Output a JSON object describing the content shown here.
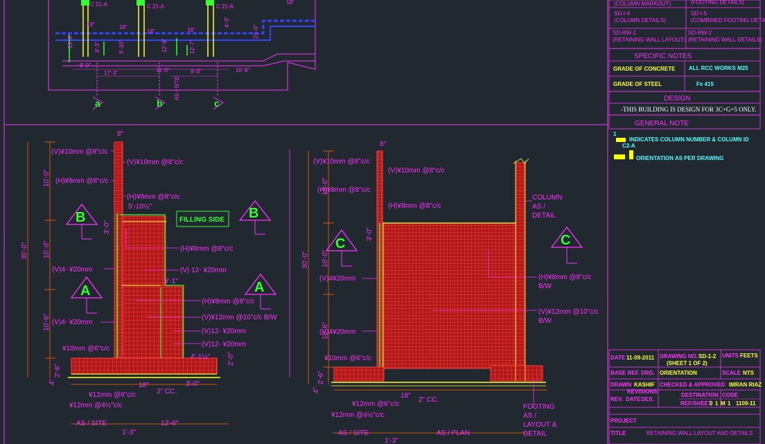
{
  "index": [
    {
      "code": "",
      "desc": "(COLUMN MARKOUT)"
    },
    {
      "code": "",
      "desc": "(FOOTING DETAILS)"
    },
    {
      "code": "SD-I-4",
      "desc": "(COLUMN DETAILS)"
    },
    {
      "code": "SD-I-5",
      "desc": "(COMBINED FOOTING DETAILS)"
    },
    {
      "code": "SD-RW-1",
      "desc": "(RETAINING WALL LAYOUT)"
    },
    {
      "code": "SD-RW-2",
      "desc": "(RETAINING WALL DETAILS)"
    }
  ],
  "specific_notes": {
    "title": "SPECIFIC NOTES",
    "concrete_label": "GRADE OF CONCRETE",
    "concrete_value": "ALL RCC WORKS M25",
    "steel_label": "GRADE OF STEEL",
    "steel_value": "Fe 415"
  },
  "design": {
    "title": "DESIGN",
    "text": "-THIS BUILDING IS DESIGN FOR 3C+G+5 ONLY."
  },
  "general_note": {
    "title": "GENERAL NOTE",
    "num": "1",
    "note1": "INDICATES COLUMN NUMBER & COLUMN ID",
    "note1b": "C2-A",
    "note2": "ORIENTATION AS PER DRAWING"
  },
  "title_block": {
    "date_label": "DATE",
    "date": "11-09-2011",
    "drawing_no_label": "DRAWING NO.",
    "drawing_no": "SD-1-2",
    "sheet": "(SHEET 1 OF 2)",
    "units_label": "UNITS",
    "units": "FEETS",
    "ref_label": "BASE REF. DRG.",
    "ref": "ORIENTATION",
    "scale_label": "SCALE",
    "scale": "NTS",
    "drawn_label": "DRAWN",
    "drawn": "KASHIF",
    "checked_label": "CHECKED & APPROVED",
    "checked": "IMRAN RIAZ",
    "revision_label": "REVISIONS",
    "destination_label": "DESTINATION",
    "ref_no_label": "REF/SHEET",
    "rev_cols": [
      "REV.",
      "DATE",
      "DES."
    ],
    "sheet_values": [
      "0",
      "1",
      "M",
      "1",
      "1109-11"
    ],
    "code_label": "CODE",
    "project_label": "PROJECT",
    "title_label": "TITLE",
    "title": "RETAINING WALL LAYOUT AND DETAILS"
  },
  "plan": {
    "col_labels": [
      "C 21-A",
      "C 21-A",
      "C 21-A"
    ],
    "grid": [
      "a",
      "b",
      "c"
    ],
    "dims": [
      "8'-0\"",
      "17'-3\"",
      "11'-0\"",
      "8'-0\"",
      "10'-8\"",
      "8'-3\"",
      "9'-10\"",
      "12'-9\"",
      "12'-7\"",
      "13'-6\"",
      "21'-0\"",
      "4'-3\""
    ],
    "as_site": "AS / SITE",
    "small": "18\""
  },
  "section1": {
    "top": "8\"",
    "v10": "(V)¥10mm @8\"c/c",
    "v10b": "(V)¥10mm @8\"c/c",
    "h8": "(H)¥8mm @8\"c/c",
    "h8b": "(H)¥8mm @8\"c/c",
    "width1": "5'-10½\"",
    "h8c": "(H)¥8mm @8\"c/c",
    "v12": "(V) 12- ¥20mm",
    "v4a": "(V)4- ¥20mm",
    "width2": "3'-1\"",
    "h8d": "(H)¥8mm @8\"c/c",
    "v12b": "(V)¥12mm @10\"c/c B/W",
    "v4b": "(V)4- ¥20mm",
    "v12c": "(V)12- ¥20mm",
    "v12d": "(V)12- ¥20mm",
    "width3": "4'-1½\"",
    "f10": "¥10mm @6\"c/c",
    "d20": "2'-0\"",
    "f12": "¥12mm @6\"c/c",
    "cc": "2\" CC.",
    "dim18": "18\"",
    "dim30": "3'-0\"",
    "f12b": "¥12mm @4½\"c/c",
    "as_site": "AS / SITE",
    "w126": "12'-6\"",
    "w13": "1'-3\"",
    "h30": "30'-0\"",
    "h100a": "10'-0\"",
    "h100b": "10'-0\"",
    "h106": "10'-6\"",
    "h26": "2'-6\"",
    "h4": "4\"",
    "h36": "3'-0\"",
    "filling": "FILLING SIDE"
  },
  "section2": {
    "top": "8\"",
    "v10": "(V)¥10mm @8\"c/c",
    "v10b": "(V)¥10mm @8\"c/c",
    "h8": "(H)¥8mm @8\"c/c",
    "h8b": "(H)¥8mm @8\"c/c",
    "v4a": "(V)4¥20mm",
    "v4b": "(V)4¥20mm",
    "column": "COLUMN",
    "column2": "AS /",
    "column3": "DETAIL",
    "h8c": "(H)¥8mm @8\"c/c",
    "bw": "B/W",
    "v12": "(V)¥12mm @10\"c/c",
    "bw2": "B/W",
    "f10": "¥10mm @6\"c/c",
    "f12": "¥12mm @6\"c/c",
    "cc": "2\" CC.",
    "dim18": "18\"",
    "f12b": "¥12mm @4½\"c/c",
    "footing": [
      "FOOTING",
      "AS /",
      "LAYOUT &",
      "DETAIL"
    ],
    "as_site": "AS / SITE",
    "as_plan": "AS / PLAN",
    "w13": "1'-3\"",
    "h30": "30'-0\"",
    "h100a": "10'-0\"",
    "h100b": "10'-0\"",
    "h106": "10'-6\"",
    "h26": "2'-6\"",
    "h4": "4\"",
    "h36": "3'-0\""
  },
  "markers": {
    "A": "A",
    "B": "B",
    "C": "C"
  },
  "colors": {
    "magenta": "#ff33ff",
    "yellow": "#ffff33",
    "green": "#33ff33",
    "red": "#ff3030",
    "blue": "#3344ff",
    "bg": "#212830"
  }
}
